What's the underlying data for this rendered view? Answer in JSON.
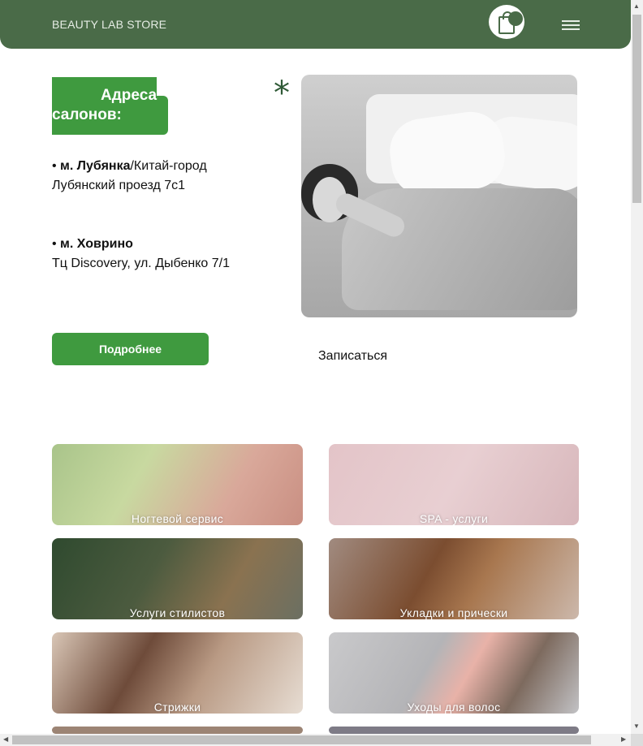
{
  "header": {
    "brand": "BEAUTY LAB STORE",
    "cart_icon": "shopping-bag-icon",
    "menu_icon": "hamburger-menu-icon",
    "color": "#4a6b48"
  },
  "addresses": {
    "title": "Адреса салонов:",
    "decor_icon": "asterisk-icon",
    "locations": [
      {
        "bullet": "• ",
        "metro": "м. Лубянка",
        "metro_extra": "/Китай-город",
        "address": "Лубянский проезд 7с1"
      },
      {
        "bullet": "• ",
        "metro": "м. Ховрино",
        "metro_extra": "",
        "address": "Тц Discovery, ул. Дыбенко 7/1"
      }
    ],
    "more_button": "Подробнее",
    "book_link": "Записаться",
    "accent_color": "#3f9a3f"
  },
  "services": [
    {
      "label": "Ногтевой сервис"
    },
    {
      "label": "SPA - услуги"
    },
    {
      "label": "Услуги стилистов"
    },
    {
      "label": "Укладки и прически"
    },
    {
      "label": "Стрижки"
    },
    {
      "label": "Уходы для волос"
    },
    {
      "label": ""
    },
    {
      "label": ""
    }
  ]
}
